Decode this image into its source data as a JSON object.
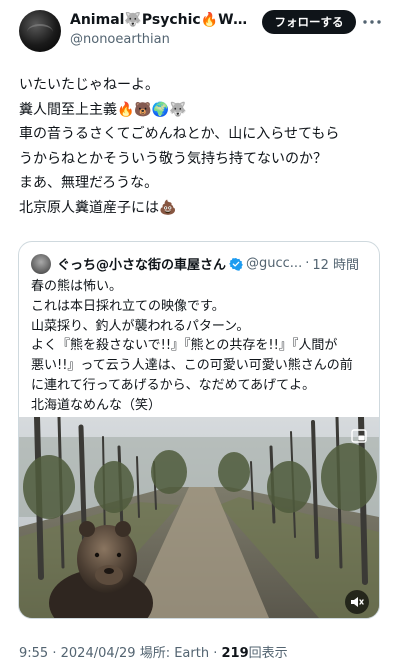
{
  "author": {
    "name": "Animal🐺Psychic🔥War...",
    "handle": "@nonoearthian"
  },
  "follow_button": "フォローする",
  "tweet_lines": [
    "いたいたじゃねーよ。",
    "糞人間至上主義🔥🐻🌍🐺",
    "車の音うるさくてごめんねとか、山に入らせてもら",
    "うからねとかそういう敬う気持ち持てないのか？",
    "まあ、無理だろうな。",
    "北京原人糞道産子には💩"
  ],
  "quote": {
    "name": "ぐっち@小さな街の車屋さん",
    "handle": "@gucc...",
    "dot": "·",
    "time": "12 時間",
    "lines": [
      "春の熊は怖い。",
      "これは本日採れ立ての映像です。",
      "山菜採り、釣人が襲われるパターン。",
      "よく『熊を殺さないで!!』『熊との共存を!!』『人間が",
      "悪い!!』って云う人達は、この可愛い可愛い熊さんの前",
      "に連れて行ってあげるから、なだめてあげてよ。",
      "北海道なめんな（笑）"
    ]
  },
  "meta": {
    "time": "9:55",
    "dot1": "·",
    "date": "2024/04/29",
    "location": "場所: Earth",
    "dot2": "·",
    "views_count": "219",
    "views_label": "回表示"
  },
  "colors": {
    "text": "#0f1419",
    "secondary": "#536471",
    "button_bg": "#0f1419",
    "border": "#cfd9de",
    "verified": "#1d9bf0"
  },
  "icons": {
    "more": "more-horizontal-icon",
    "verified": "verified-badge-icon",
    "mute": "speaker-muted-icon",
    "pip": "picture-in-picture-icon"
  }
}
